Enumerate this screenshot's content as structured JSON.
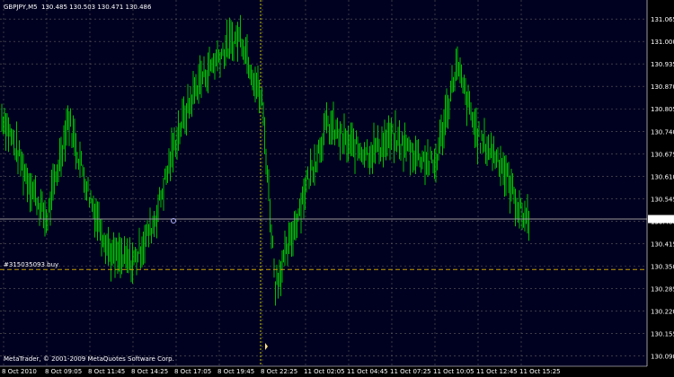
{
  "window": {
    "symbol_label": "GBPJPY,M5",
    "ohlc_label": "130.485 130.503 130.471 130.486",
    "copyright": "MetaTrader, © 2001-2009 MetaQuotes Software Corp.",
    "order_label": "#315035093 buy"
  },
  "colors": {
    "background": "#000000",
    "plot_background": "#000020",
    "candles": "#00c000",
    "grid": "#606060",
    "price_line": "#9a9a9a",
    "order_line": "#c8a000",
    "text": "#ffffff",
    "current_price_bg": "#ffffff",
    "current_price_text": "#000000"
  },
  "chart_data": {
    "type": "line",
    "symbol": "GBPJPY",
    "timeframe": "M5",
    "ylim": [
      130.06,
      131.12
    ],
    "y_ticks": [
      131.065,
      131.0,
      130.935,
      130.87,
      130.805,
      130.74,
      130.675,
      130.61,
      130.545,
      130.48,
      130.415,
      130.35,
      130.285,
      130.22,
      130.155,
      130.09
    ],
    "x_ticks": [
      "8 Oct 2010",
      "8 Oct 09:05",
      "8 Oct 11:45",
      "8 Oct 14:25",
      "8 Oct 17:05",
      "8 Oct 19:45",
      "8 Oct 22:25",
      "11 Oct 02:05",
      "11 Oct 04:45",
      "11 Oct 07:25",
      "11 Oct 10:05",
      "11 Oct 12:45",
      "11 Oct 15:25"
    ],
    "current_price": 130.486,
    "order_price": 130.34,
    "period_separator_index": 6,
    "series": [
      {
        "x": [
          0,
          0.5,
          1,
          1.5,
          2,
          2.5,
          3,
          3.5,
          4,
          4.5,
          5,
          5.5,
          6,
          6.3,
          6.6,
          7,
          7.5,
          8,
          8.5,
          9,
          9.5,
          10,
          10.5,
          11,
          11.5,
          12,
          12.2
        ],
        "values": [
          130.78,
          130.62,
          130.48,
          130.78,
          130.55,
          130.38,
          130.36,
          130.48,
          130.72,
          130.88,
          130.96,
          131.02,
          130.82,
          130.3,
          130.4,
          130.58,
          130.76,
          130.7,
          130.68,
          130.72,
          130.68,
          130.64,
          130.93,
          130.72,
          130.66,
          130.5,
          130.49
        ]
      }
    ]
  }
}
